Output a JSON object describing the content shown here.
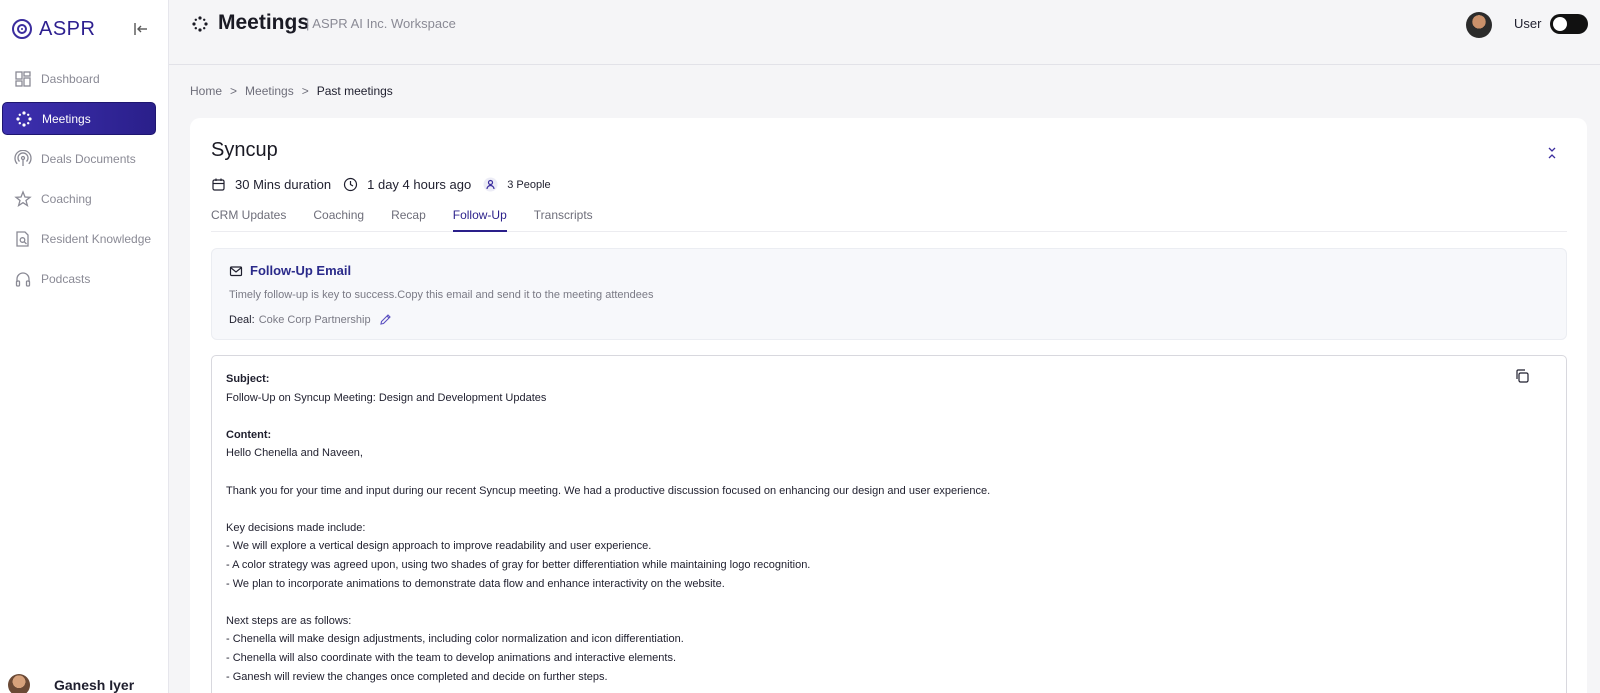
{
  "brand": {
    "name": "ASPR"
  },
  "sidebar": {
    "items": [
      {
        "label": "Dashboard",
        "icon": "dashboard-icon",
        "active": false
      },
      {
        "label": "Meetings",
        "icon": "meetings-icon",
        "active": true
      },
      {
        "label": "Deals Documents",
        "icon": "broadcast-icon",
        "active": false
      },
      {
        "label": "Coaching",
        "icon": "star-icon",
        "active": false
      },
      {
        "label": "Resident Knowledge",
        "icon": "document-search-icon",
        "active": false
      },
      {
        "label": "Podcasts",
        "icon": "headphones-icon",
        "active": false
      }
    ],
    "user_name": "Ganesh Iyer"
  },
  "header": {
    "title": "Meetings",
    "subtitle": "| ASPR AI Inc. Workspace",
    "user_label": "User"
  },
  "breadcrumb": {
    "home": "Home",
    "sep1": ">",
    "meetings": "Meetings",
    "sep2": ">",
    "current": "Past meetings"
  },
  "meeting": {
    "title": "Syncup",
    "duration": "30 Mins duration",
    "time_ago": "1 day 4 hours ago",
    "people": "3 People"
  },
  "tabs": [
    {
      "label": "CRM Updates",
      "active": false
    },
    {
      "label": "Coaching",
      "active": false
    },
    {
      "label": "Recap",
      "active": false
    },
    {
      "label": "Follow-Up",
      "active": true
    },
    {
      "label": "Transcripts",
      "active": false
    }
  ],
  "follow_up": {
    "title": "Follow-Up Email",
    "description": "Timely follow-up is key to success.Copy this email and send it to the meeting attendees",
    "deal_label": "Deal:",
    "deal_value": "Coke Corp Partnership"
  },
  "email": {
    "subject_label": "Subject:",
    "subject": "Follow-Up on Syncup Meeting: Design and Development Updates",
    "content_label": "Content:",
    "greeting": "Hello Chenella and Naveen,",
    "intro": "Thank you for your time and input during our recent Syncup meeting. We had a productive discussion focused on enhancing our design and user experience.",
    "decisions_header": "Key decisions made include:",
    "decisions": [
      "- We will explore a vertical design approach to improve readability and user experience.",
      "- A color strategy was agreed upon, using two shades of gray for better differentiation while maintaining logo recognition.",
      "- We plan to incorporate animations to demonstrate data flow and enhance interactivity on the website."
    ],
    "next_header": "Next steps are as follows:",
    "next_steps": [
      "- Chenella will make design adjustments, including color normalization and icon differentiation.",
      "- Chenella will also coordinate with the team to develop animations and interactive elements.",
      "- Ganesh will review the changes once completed and decide on further steps."
    ]
  },
  "colors": {
    "accent": "#2a1f8a",
    "nav_active_bg": "#3d30b0",
    "background": "#f5f5f7"
  }
}
